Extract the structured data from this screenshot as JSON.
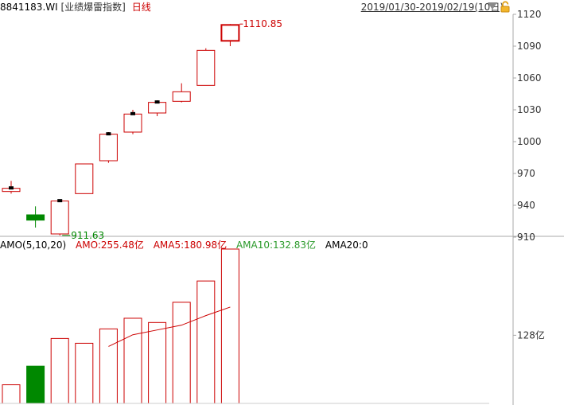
{
  "header": {
    "code": "8841183.WI",
    "name": "[业绩爆雷指数]",
    "period": "日线",
    "range": "2019/01/30-2019/02/19(10日)",
    "dropdown_icon": "triangle-down-icon",
    "lock_icon": "lock-open-icon"
  },
  "amo_legend": {
    "title": "AMO(5,10,20)",
    "amo": "AMO:255.48亿",
    "ma5": "AMA5:180.98亿",
    "ma10": "AMA10:132.83亿",
    "ma20": "AMA20:0"
  },
  "colors": {
    "up": "#cc0000",
    "down": "#008800",
    "ma10": "#2a9a2a",
    "grid": "#dddddd",
    "axis": "#aaaaaa"
  },
  "chart_data": [
    {
      "type": "candlestick",
      "y_ticks": [
        1120,
        1090,
        1060,
        1030,
        1000,
        970,
        940,
        910
      ],
      "ylim": [
        898,
        1127
      ],
      "candles": [
        {
          "open": 953,
          "close": 956,
          "high": 963,
          "low": 951,
          "dir": "up"
        },
        {
          "open": 931,
          "close": 926,
          "high": 939,
          "low": 919,
          "dir": "down"
        },
        {
          "open": 913,
          "close": 944,
          "high": 945,
          "low": 911.63,
          "dir": "up"
        },
        {
          "open": 951,
          "close": 979,
          "high": 979,
          "low": 951,
          "dir": "up"
        },
        {
          "open": 982,
          "close": 1007,
          "high": 1009,
          "low": 980,
          "dir": "up"
        },
        {
          "open": 1009,
          "close": 1026,
          "high": 1030,
          "low": 1007,
          "dir": "up"
        },
        {
          "open": 1027,
          "close": 1037,
          "high": 1039,
          "low": 1024,
          "dir": "up"
        },
        {
          "open": 1038,
          "close": 1047,
          "high": 1055,
          "low": 1037,
          "dir": "up"
        },
        {
          "open": 1053,
          "close": 1086,
          "high": 1088,
          "low": 1053,
          "dir": "up"
        },
        {
          "open": 1095,
          "close": 1110,
          "high": 1110.85,
          "low": 1090,
          "dir": "up"
        }
      ],
      "annotations": {
        "high_label": "1110.85",
        "low_label": "911.63"
      }
    },
    {
      "type": "bar",
      "title": "AMO(5,10,20)",
      "y_tick_label": "128亿",
      "y_tick_value": 128,
      "ylim": [
        0,
        290
      ],
      "values": [
        35,
        70,
        122,
        113,
        140,
        160,
        152,
        190,
        230,
        290
      ],
      "bar_dirs": [
        "up",
        "down",
        "up",
        "up",
        "up",
        "up",
        "up",
        "up",
        "up",
        "up"
      ],
      "series": [
        {
          "name": "AMA5",
          "values": [
            null,
            null,
            null,
            null,
            107,
            129,
            138,
            147,
            165,
            180.98
          ]
        }
      ]
    }
  ]
}
